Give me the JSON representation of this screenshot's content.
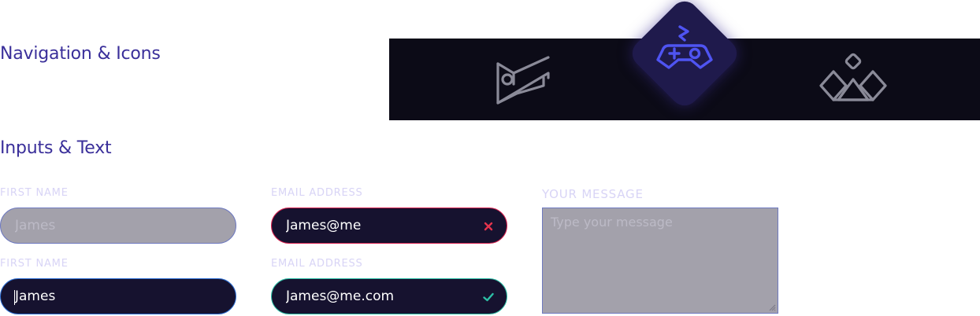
{
  "sections": {
    "navigation_title": "Navigation & Icons",
    "inputs_title": "Inputs & Text"
  },
  "navbar": {
    "items": [
      {
        "icon": "book-icon",
        "active": false
      },
      {
        "icon": "gamepad-icon",
        "active": true
      },
      {
        "icon": "shapes-icon",
        "active": false
      }
    ],
    "colors": {
      "background": "#0c0b17",
      "active_tile": "#1f1a4c",
      "active_icon": "#4f54f2",
      "inactive_icon": "#8a8a98"
    }
  },
  "form": {
    "first_name_disabled": {
      "label": "FIRST NAME",
      "placeholder": "James",
      "state": "disabled"
    },
    "first_name_focused": {
      "label": "FIRST NAME",
      "value": "James",
      "state": "focused"
    },
    "email_error": {
      "label": "EMAIL ADDRESS",
      "value": "James@me",
      "state": "error",
      "icon": "close-icon"
    },
    "email_valid": {
      "label": "EMAIL ADDRESS",
      "value": "James@me.com",
      "state": "valid",
      "icon": "check-icon"
    },
    "message": {
      "label": "YOUR MESSAGE",
      "placeholder": "Type your message",
      "state": "disabled"
    }
  },
  "colors": {
    "title": "#3a2f9a",
    "label": "#d8d4f6",
    "input_background": "#16122f",
    "disabled_background": "#a3a1ab",
    "error": "#d61f4e",
    "focus": "#2e6fd4",
    "success": "#2dbfa6"
  }
}
